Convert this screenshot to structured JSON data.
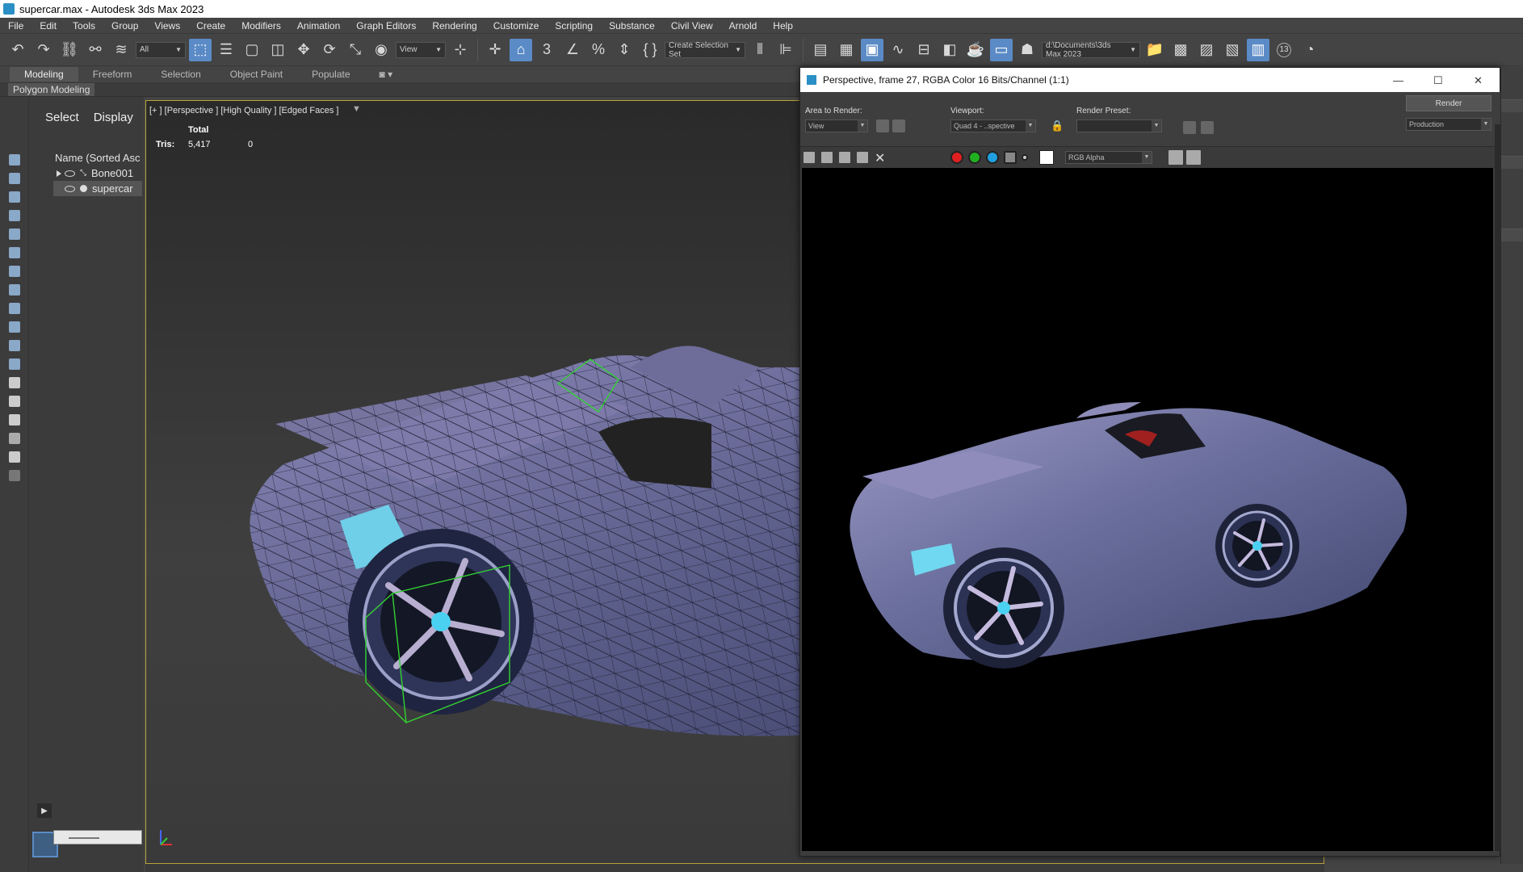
{
  "window": {
    "title": "supercar.max - Autodesk 3ds Max 2023"
  },
  "menu": [
    "File",
    "Edit",
    "Tools",
    "Group",
    "Views",
    "Create",
    "Modifiers",
    "Animation",
    "Graph Editors",
    "Rendering",
    "Customize",
    "Scripting",
    "Substance",
    "Civil View",
    "Arnold",
    "Help"
  ],
  "toolbar": {
    "filter_value": "All",
    "coord_value": "View",
    "selection_set_value": "Create Selection Set",
    "project_path": "d:\\Documents\\3ds Max 2023",
    "ref_count": "13"
  },
  "ribbon": {
    "tabs": [
      "Modeling",
      "Freeform",
      "Selection",
      "Object Paint",
      "Populate"
    ],
    "active_tab": "Modeling",
    "sub_label": "Polygon Modeling"
  },
  "explorer": {
    "tab_select": "Select",
    "tab_display": "Display",
    "column_header": "Name (Sorted Asc",
    "rows": [
      {
        "label": "Bone001"
      },
      {
        "label": "supercar"
      }
    ]
  },
  "viewport": {
    "label": "[+ ] [Perspective ] [High Quality ] [Edged Faces ]",
    "stats_header": "Total",
    "stats_label": "Tris:",
    "stats_total": "5,417",
    "stats_selected": "0"
  },
  "render_window": {
    "title": "Perspective, frame 27, RGBA Color 16 Bits/Channel (1:1)",
    "area_label": "Area to Render:",
    "area_value": "View",
    "viewport_label": "Viewport:",
    "viewport_value": "Quad 4 - ..spective",
    "preset_label": "Render Preset:",
    "preset_value": "",
    "render_button": "Render",
    "production_value": "Production",
    "channel_value": "RGB Alpha"
  },
  "colors": {
    "accent": "#5b8bc6",
    "viewport_border": "#b8a33a",
    "selection_green": "#3dc23d",
    "car_body": "#5b5f88"
  }
}
